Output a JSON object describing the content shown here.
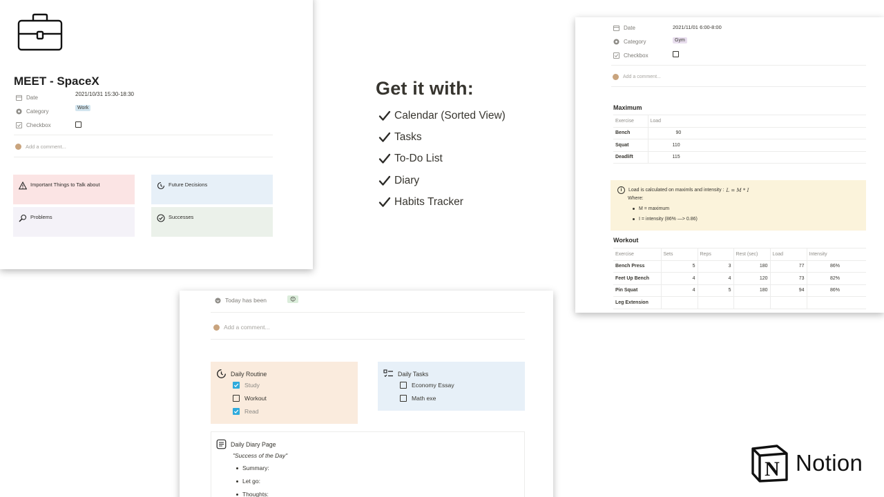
{
  "meet": {
    "title": "MEET - SpaceX",
    "props": [
      {
        "icon": "calendar-icon",
        "label": "Date",
        "value": "2021/10/31 15:30-18:30"
      },
      {
        "icon": "category-icon",
        "label": "Category",
        "value": "Work"
      },
      {
        "icon": "checkbox-icon",
        "label": "Checkbox",
        "value": ""
      }
    ],
    "comment_placeholder": "Add a comment...",
    "callouts": [
      {
        "icon": "warning-icon",
        "label": "Important Things to Talk about",
        "color": "#fbe4e4"
      },
      {
        "icon": "clock-icon",
        "label": "Future Decisions",
        "color": "#e7f0f8"
      },
      {
        "icon": "magnifier-icon",
        "label": "Problems",
        "color": "#f4f2f8"
      },
      {
        "icon": "check-circle-icon",
        "label": "Successes",
        "color": "#ebf1ea"
      }
    ],
    "tag_color": "#d3e5ef"
  },
  "features": {
    "heading": "Get it with:",
    "items": [
      "Calendar (Sorted View)",
      "Tasks",
      "To-Do List",
      "Diary",
      "Habits Tracker"
    ]
  },
  "gym": {
    "props": [
      {
        "icon": "calendar-icon",
        "label": "Date",
        "value": "2021/11/01 6:00-8:00"
      },
      {
        "icon": "category-icon",
        "label": "Category",
        "value": "Gym"
      },
      {
        "icon": "checkbox-icon",
        "label": "Checkbox",
        "value": ""
      }
    ],
    "comment_placeholder": "Add a comment...",
    "tag_color": "#e8deee",
    "maximum": {
      "title": "Maximum",
      "columns": [
        "Exercise",
        "Load"
      ],
      "rows": [
        [
          "Bench",
          "90"
        ],
        [
          "Squat",
          "110"
        ],
        [
          "Deadlift",
          "115"
        ]
      ]
    },
    "info": {
      "text": "Load is calculated on maximls and intensity :",
      "formula": "L = M * I",
      "where": "Where:",
      "bullets": [
        "M = maximum",
        "I = intensity (86% —> 0.86)"
      ],
      "color": "#fbf3db"
    },
    "workout": {
      "title": "Workout",
      "columns": [
        "Exercise",
        "Sets",
        "Reps",
        "Rest (sec)",
        "Load",
        "Intensity"
      ],
      "rows": [
        [
          "Bench Press",
          "5",
          "3",
          "180",
          "77",
          "86%"
        ],
        [
          "Feet Up Bench",
          "4",
          "4",
          "120",
          "73",
          "82%"
        ],
        [
          "Pin Squat",
          "4",
          "5",
          "180",
          "94",
          "86%"
        ],
        [
          "Leg Extension",
          "",
          "",
          "",
          "",
          ""
        ]
      ]
    }
  },
  "diary": {
    "today_label": "Today has been",
    "today_value": "😊",
    "comment_placeholder": "Add a comment...",
    "routine": {
      "title": "Daily Routine",
      "color": "#faebdd",
      "items": [
        {
          "label": "Study",
          "checked": true
        },
        {
          "label": "Workout",
          "checked": false
        },
        {
          "label": "Read",
          "checked": true
        }
      ]
    },
    "tasks": {
      "title": "Daily Tasks",
      "color": "#e7f0f8",
      "items": [
        {
          "label": "Economy Essay",
          "checked": false
        },
        {
          "label": "Math exe",
          "checked": false
        }
      ]
    },
    "page": {
      "title": "Daily Diary Page",
      "quote": "\"Success of the Day\"",
      "bullets": [
        "Summary:",
        "Let go:",
        "Thoughts:"
      ]
    }
  },
  "brand": {
    "name": "Notion",
    "mark": "N"
  }
}
